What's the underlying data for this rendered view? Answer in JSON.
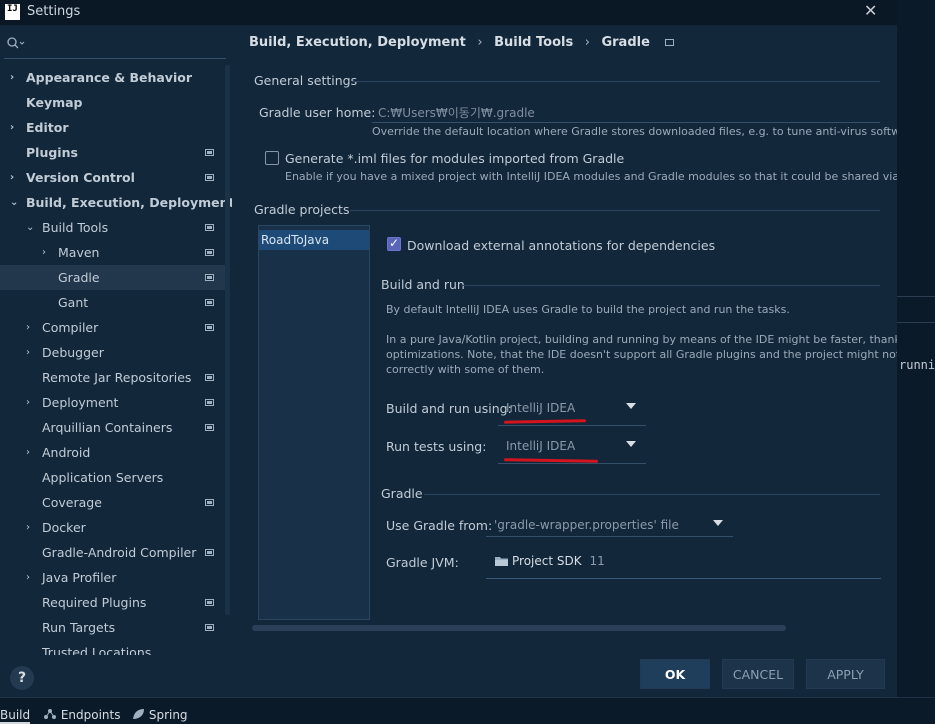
{
  "window": {
    "title": "Settings",
    "close_glyph": "✕"
  },
  "sidebar": {
    "search_icon": "search-icon",
    "items": [
      {
        "label": "Appearance & Behavior",
        "arrow": "›",
        "level": 0,
        "bold": true,
        "gear": false,
        "selected": false
      },
      {
        "label": "Keymap",
        "arrow": "",
        "level": 0,
        "bold": true,
        "gear": false,
        "selected": false
      },
      {
        "label": "Editor",
        "arrow": "›",
        "level": 0,
        "bold": true,
        "gear": false,
        "selected": false
      },
      {
        "label": "Plugins",
        "arrow": "",
        "level": 0,
        "bold": true,
        "gear": true,
        "selected": false
      },
      {
        "label": "Version Control",
        "arrow": "›",
        "level": 0,
        "bold": true,
        "gear": true,
        "selected": false
      },
      {
        "label": "Build, Execution, Deployment",
        "arrow": "⌄",
        "level": 0,
        "bold": true,
        "gear": false,
        "selected": false
      },
      {
        "label": "Build Tools",
        "arrow": "⌄",
        "level": 1,
        "bold": false,
        "gear": true,
        "selected": false
      },
      {
        "label": "Maven",
        "arrow": "›",
        "level": 2,
        "bold": false,
        "gear": true,
        "selected": false
      },
      {
        "label": "Gradle",
        "arrow": "",
        "level": 2,
        "bold": false,
        "gear": true,
        "selected": true
      },
      {
        "label": "Gant",
        "arrow": "",
        "level": 2,
        "bold": false,
        "gear": true,
        "selected": false
      },
      {
        "label": "Compiler",
        "arrow": "›",
        "level": 1,
        "bold": false,
        "gear": true,
        "selected": false
      },
      {
        "label": "Debugger",
        "arrow": "›",
        "level": 1,
        "bold": false,
        "gear": false,
        "selected": false
      },
      {
        "label": "Remote Jar Repositories",
        "arrow": "",
        "level": 1,
        "bold": false,
        "gear": true,
        "selected": false
      },
      {
        "label": "Deployment",
        "arrow": "›",
        "level": 1,
        "bold": false,
        "gear": true,
        "selected": false
      },
      {
        "label": "Arquillian Containers",
        "arrow": "",
        "level": 1,
        "bold": false,
        "gear": true,
        "selected": false
      },
      {
        "label": "Android",
        "arrow": "›",
        "level": 1,
        "bold": false,
        "gear": false,
        "selected": false
      },
      {
        "label": "Application Servers",
        "arrow": "",
        "level": 1,
        "bold": false,
        "gear": false,
        "selected": false
      },
      {
        "label": "Coverage",
        "arrow": "",
        "level": 1,
        "bold": false,
        "gear": true,
        "selected": false
      },
      {
        "label": "Docker",
        "arrow": "›",
        "level": 1,
        "bold": false,
        "gear": false,
        "selected": false
      },
      {
        "label": "Gradle-Android Compiler",
        "arrow": "",
        "level": 1,
        "bold": false,
        "gear": true,
        "selected": false
      },
      {
        "label": "Java Profiler",
        "arrow": "›",
        "level": 1,
        "bold": false,
        "gear": false,
        "selected": false
      },
      {
        "label": "Required Plugins",
        "arrow": "",
        "level": 1,
        "bold": false,
        "gear": true,
        "selected": false
      },
      {
        "label": "Run Targets",
        "arrow": "",
        "level": 1,
        "bold": false,
        "gear": true,
        "selected": false
      },
      {
        "label": "Trusted Locations",
        "arrow": "",
        "level": 1,
        "bold": false,
        "gear": false,
        "selected": false
      }
    ],
    "help_label": "?"
  },
  "breadcrumb": [
    "Build, Execution, Deployment",
    "Build Tools",
    "Gradle"
  ],
  "breadcrumb_sep": "›",
  "general": {
    "title": "General settings",
    "user_home_label": "Gradle user home:",
    "user_home_value": "C:₩Users₩이동기₩.gradle",
    "user_home_hint": "Override the default location where Gradle stores downloaded files, e.g. to tune anti-virus software",
    "iml_label": "Generate *.iml files for modules imported from Gradle",
    "iml_checked": false,
    "iml_hint": "Enable if you have a mixed project with IntelliJ IDEA modules and Gradle modules so that it could be shared via VC"
  },
  "projects": {
    "title": "Gradle projects",
    "list": [
      "RoadToJava"
    ],
    "download_annotations_label": "Download external annotations for dependencies",
    "download_annotations_checked": true
  },
  "build_run": {
    "title": "Build and run",
    "desc1": "By default IntelliJ IDEA uses Gradle to build the project and run the tasks.",
    "desc2": "In a pure Java/Kotlin project, building and running by means of the IDE might be faster, thanks t",
    "desc3": "optimizations. Note, that the IDE doesn't support all Gradle plugins and the project might not b",
    "desc4": "correctly with some of them.",
    "build_run_label": "Build and run using:",
    "build_run_value": "IntelliJ IDEA",
    "run_tests_label": "Run tests using:",
    "run_tests_value": "IntelliJ IDEA"
  },
  "gradle": {
    "title": "Gradle",
    "use_from_label": "Use Gradle from:",
    "use_from_value": "'gradle-wrapper.properties' file",
    "jvm_label": "Gradle JVM:",
    "jvm_value": "Project SDK",
    "jvm_version": "11"
  },
  "buttons": {
    "ok": "OK",
    "cancel": "CANCEL",
    "apply": "APPLY"
  },
  "backdrop_text": "running",
  "status_tabs": [
    {
      "label": "Build",
      "icon": ""
    },
    {
      "label": "Endpoints",
      "icon": "endpoints-icon"
    },
    {
      "label": "Spring",
      "icon": "spring-leaf-icon"
    }
  ],
  "colors": {
    "accent": "#5a64b8",
    "annotation": "#d4141e",
    "selection": "#1e4a78"
  }
}
